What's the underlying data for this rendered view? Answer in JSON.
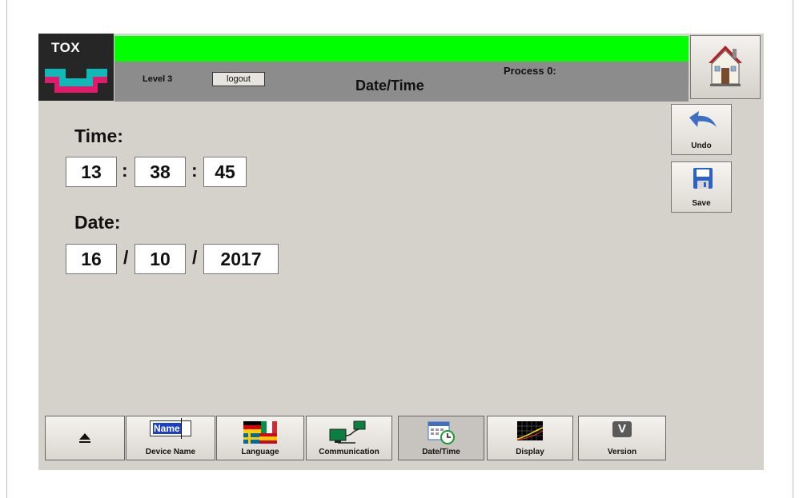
{
  "header": {
    "brand": "TOX®",
    "brand_short": "TOX",
    "level": "Level 3",
    "logout_label": "logout",
    "process": "Process 0:",
    "title": "Date/Time",
    "status_color": "#00ff00"
  },
  "side": {
    "undo_label": "Undo",
    "save_label": "Save"
  },
  "time": {
    "label": "Time:",
    "hours": "13",
    "minutes": "38",
    "seconds": "45",
    "separator": ":"
  },
  "date": {
    "label": "Date:",
    "day": "16",
    "month": "10",
    "year": "2017",
    "separator": "/"
  },
  "tabs": [
    {
      "label": "",
      "icon": "eject-icon"
    },
    {
      "label": "Device Name",
      "icon": "name-field-icon",
      "icon_text": "Name"
    },
    {
      "label": "Language",
      "icon": "flags-icon"
    },
    {
      "label": "Communication",
      "icon": "network-icon"
    },
    {
      "label": "Date/Time",
      "icon": "calendar-clock-icon",
      "active": true
    },
    {
      "label": "Display",
      "icon": "display-graph-icon"
    },
    {
      "label": "Version",
      "icon": "version-icon",
      "icon_text": "V"
    }
  ]
}
